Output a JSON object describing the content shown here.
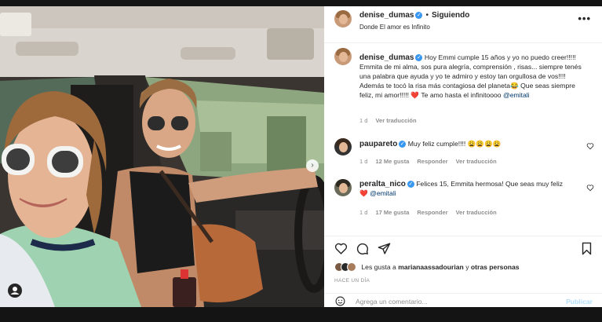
{
  "post": {
    "author": "denise_dumas",
    "follow_label": "Siguiendo",
    "separator": "•",
    "location": "Donde El amor es Infinito",
    "more_icon": "more-horizontal-icon",
    "photo_alt": "Selfie de madre e hija en el auto"
  },
  "caption": {
    "author": "denise_dumas",
    "text": "Hoy Emmi cumple 15 años y yo no puedo creer!!!!! Emmita de mi alma, sos pura alegría, comprensión , risas... siempre tenés una palabra que ayuda y yo te admiro y estoy tan orgullosa de vos!!!! Además te tocó la risa más contagiosa del planeta😂 Que seas siempre feliz, mi amor!!!!! ❤️ Te amo hasta el infinitoooo",
    "mention": "@emitali",
    "age": "1 d",
    "see_translation": "Ver traducción"
  },
  "comments": [
    {
      "user": "paupareto",
      "text": "Muy feliz cumple!!!! 😩😩😩😩",
      "age": "1 d",
      "likes": "12 Me gusta",
      "reply": "Responder",
      "see_translation": "Ver traducción"
    },
    {
      "user": "peralta_nico",
      "text": "Felices 15, Emmita hermosa! Que seas muy feliz",
      "text2": "❤️",
      "mention": "@emitali",
      "age": "1 d",
      "likes": "17 Me gusta",
      "reply": "Responder",
      "see_translation": "Ver traducción"
    }
  ],
  "likes": {
    "prefix": "Les gusta a",
    "user": "marianaassadourian",
    "connector": "y",
    "others": "otras personas"
  },
  "time_label": "HACE UN DÍA",
  "add_comment": {
    "placeholder": "Agrega un comentario...",
    "publish": "Publicar"
  },
  "colors": {
    "link": "#00376b",
    "verified": "#3897f0",
    "heart": "#ed4956",
    "muted": "#8e8e8e"
  }
}
